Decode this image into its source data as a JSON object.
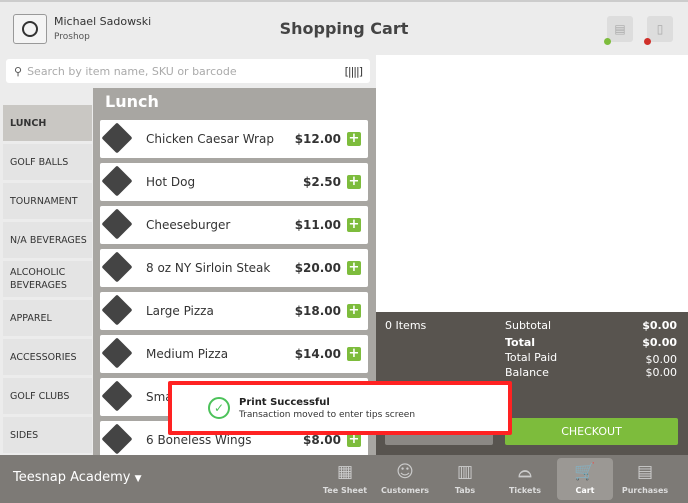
{
  "header": {
    "user_name": "Michael Sadowski",
    "user_role": "Proshop",
    "title": "Shopping Cart",
    "printer_status_color": "#7dbc3c",
    "drawer_status_color": "#d0302a"
  },
  "search": {
    "placeholder": "Search by item name, SKU or barcode"
  },
  "categories": [
    "LUNCH",
    "GOLF BALLS",
    "TOURNAMENT",
    "N/A BEVERAGES",
    "ALCOHOLIC BEVERAGES",
    "APPAREL",
    "ACCESSORIES",
    "GOLF CLUBS",
    "SIDES"
  ],
  "active_category": "LUNCH",
  "panel_title": "Lunch",
  "items": [
    {
      "name": "Chicken Caesar Wrap",
      "price": "$12.00"
    },
    {
      "name": "Hot Dog",
      "price": "$2.50"
    },
    {
      "name": "Cheeseburger",
      "price": "$11.00"
    },
    {
      "name": "8 oz NY Sirloin Steak",
      "price": "$20.00"
    },
    {
      "name": "Large Pizza",
      "price": "$18.00"
    },
    {
      "name": "Medium Pizza",
      "price": "$14.00"
    },
    {
      "name": "Sma",
      "price": ""
    },
    {
      "name": "6 Boneless Wings",
      "price": "$8.00"
    }
  ],
  "summary": {
    "items": "0 Items",
    "subtotal_label": "Subtotal",
    "subtotal": "$0.00",
    "total_label": "Total",
    "total": "$0.00",
    "paid_label": "Total Paid",
    "paid": "$0.00",
    "balance_label": "Balance",
    "balance": "$0.00",
    "checkout": "CHECKOUT"
  },
  "footer": {
    "location": "Teesnap Academy",
    "nav": [
      {
        "label": "Tee Sheet",
        "icon": "calendar-icon"
      },
      {
        "label": "Customers",
        "icon": "users-icon"
      },
      {
        "label": "Tabs",
        "icon": "tabs-icon"
      },
      {
        "label": "Tickets",
        "icon": "bell-icon"
      },
      {
        "label": "Cart",
        "icon": "cart-icon"
      },
      {
        "label": "Purchases",
        "icon": "register-icon"
      }
    ],
    "active": "Cart"
  },
  "toast": {
    "title": "Print Successful",
    "message": "Transaction moved to enter tips screen"
  }
}
